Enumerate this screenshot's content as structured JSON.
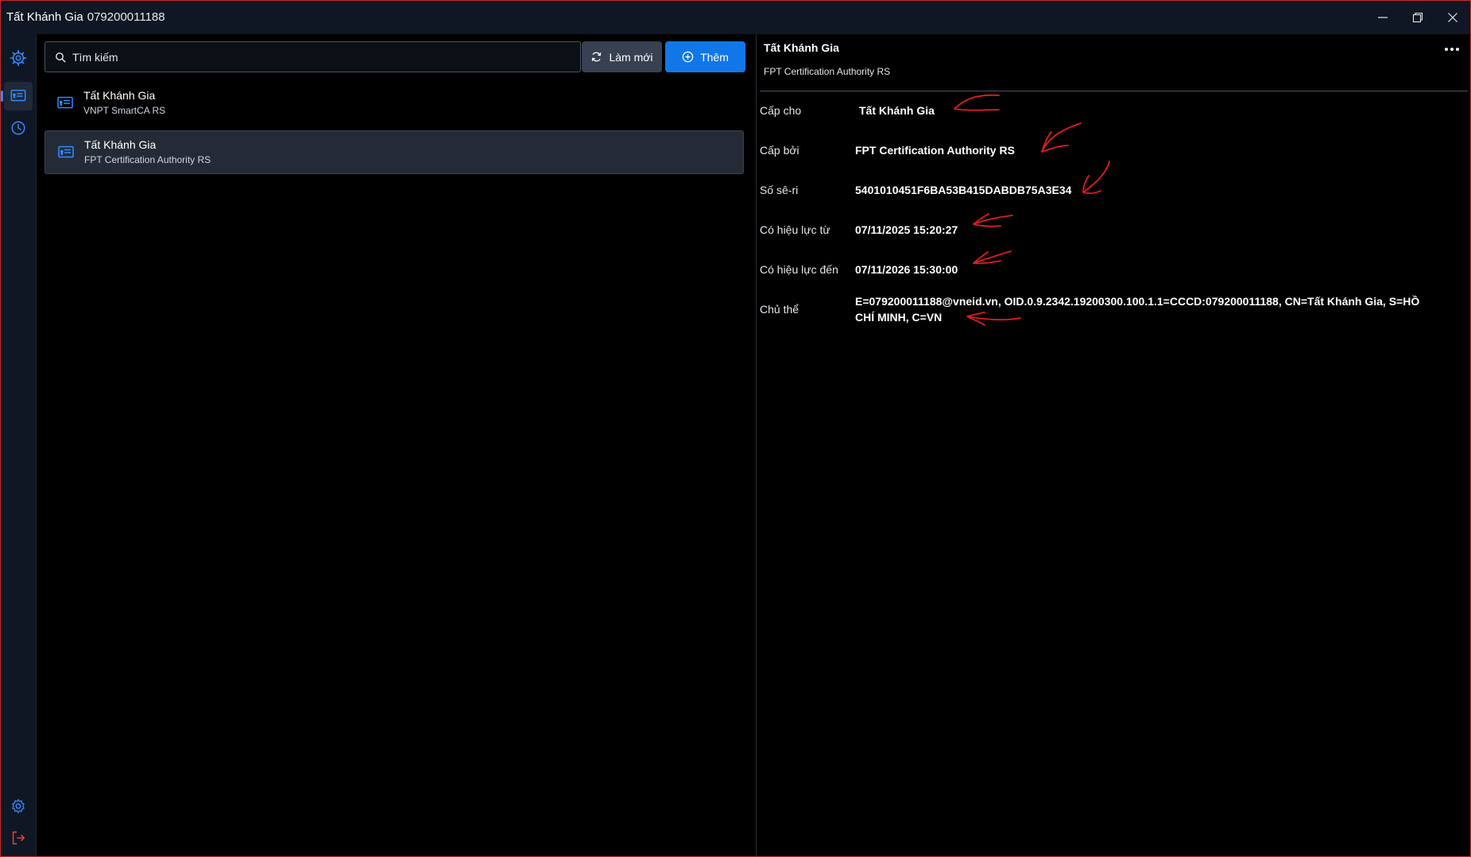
{
  "window": {
    "title": "Tất Khánh Gia",
    "title_number": "079200011188",
    "controls": [
      "minimize-icon",
      "restore-icon",
      "close-icon"
    ]
  },
  "rail": {
    "items": [
      {
        "name": "logo",
        "icon": "gear-cluster-icon"
      },
      {
        "name": "certificates",
        "icon": "certificate-icon",
        "active": true
      },
      {
        "name": "history",
        "icon": "clock-icon"
      },
      {
        "name": "settings",
        "icon": "gear-icon"
      },
      {
        "name": "logout",
        "icon": "logout-icon"
      }
    ]
  },
  "toolbar": {
    "search_placeholder": "Tìm kiếm",
    "refresh_label": "Làm mới",
    "add_label": "Thêm"
  },
  "list": {
    "items": [
      {
        "name": "Tất Khánh Gia",
        "issuer": "VNPT SmartCA RS",
        "selected": false
      },
      {
        "name": "Tất Khánh Gia",
        "issuer": "FPT Certification Authority RS",
        "selected": true
      }
    ]
  },
  "detail": {
    "title": "Tất Khánh Gia",
    "subtitle": "FPT Certification Authority RS",
    "rows": [
      {
        "label": "Cấp cho",
        "value": "Tất Khánh Gia"
      },
      {
        "label": "Cấp bởi",
        "value": "FPT Certification Authority RS"
      },
      {
        "label": "Số sê-ri",
        "value": "5401010451F6BA53B415DABDB75A3E34"
      },
      {
        "label": "Có hiệu lực từ",
        "value": "07/11/2025 15:20:27"
      },
      {
        "label": "Có hiệu lực đến",
        "value": "07/11/2026 15:30:00"
      },
      {
        "label": "Chủ thể",
        "value_line1": "E=079200011188@vneid.vn, OID.0.9.2342.19200300.100.1.1=CCCD:079200011188, CN=Tất Khánh Gia, S=HỒ",
        "value_line2": "CHÍ MINH, C=VN"
      }
    ]
  },
  "colors": {
    "accent": "#1177e8",
    "titlebar": "#0f1724",
    "selected_row": "#252b36",
    "annotation": "#e11d1d"
  }
}
